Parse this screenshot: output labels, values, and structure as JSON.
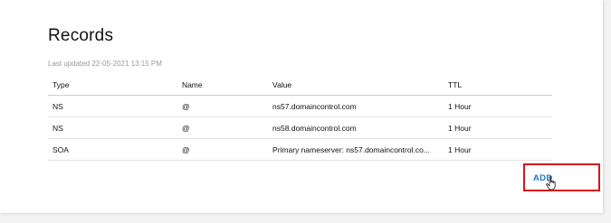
{
  "records_panel": {
    "title": "Records",
    "last_updated": "Last updated 22-05-2021 13:15 PM",
    "columns": [
      "Type",
      "Name",
      "Value",
      "TTL"
    ],
    "rows": [
      {
        "type": "NS",
        "name": "@",
        "value": "ns57.domaincontrol.com",
        "ttl": "1 Hour"
      },
      {
        "type": "NS",
        "name": "@",
        "value": "ns58.domaincontrol.com",
        "ttl": "1 Hour"
      },
      {
        "type": "SOA",
        "name": "@",
        "value": "Primary nameserver: ns57.domaincontrol.co...",
        "ttl": "1 Hour"
      }
    ],
    "add_label": "ADD"
  },
  "colors": {
    "accent_link": "#1976d2",
    "highlight_border": "#d9161b"
  },
  "icons": {
    "cursor": "hand-pointer-icon"
  }
}
